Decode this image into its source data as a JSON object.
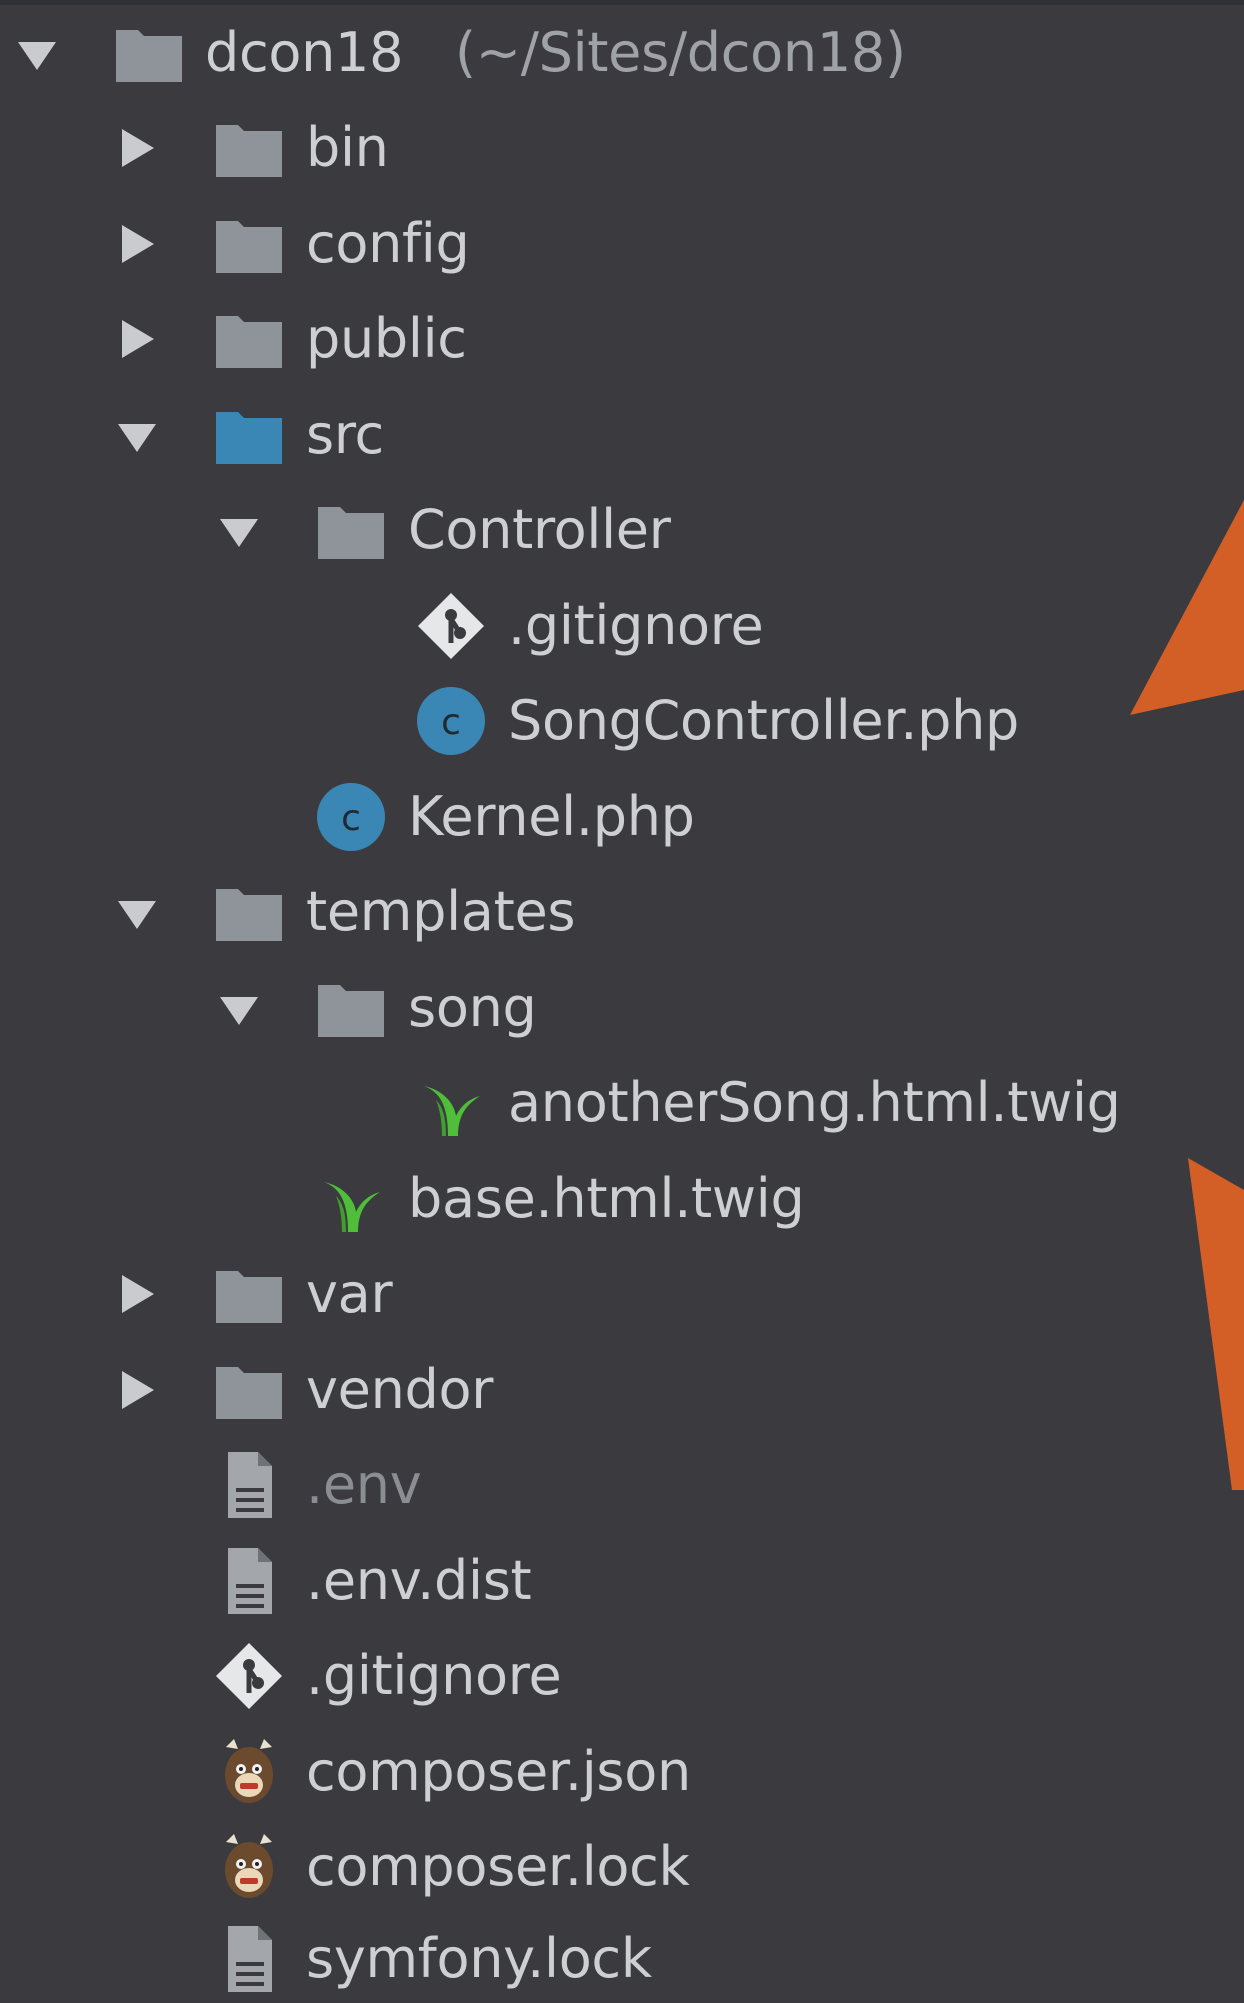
{
  "project": {
    "name": "dcon18",
    "path": "(~/Sites/dcon18)"
  },
  "items": [
    {
      "label": "bin",
      "type": "folder",
      "state": "collapsed"
    },
    {
      "label": "config",
      "type": "folder",
      "state": "collapsed"
    },
    {
      "label": "public",
      "type": "folder",
      "state": "collapsed"
    },
    {
      "label": "src",
      "type": "folder-source",
      "state": "expanded"
    },
    {
      "label": "Controller",
      "type": "folder",
      "state": "expanded"
    },
    {
      "label": ".gitignore",
      "type": "git-file"
    },
    {
      "label": "SongController.php",
      "type": "php-class-file"
    },
    {
      "label": "Kernel.php",
      "type": "php-class-file"
    },
    {
      "label": "templates",
      "type": "folder",
      "state": "expanded"
    },
    {
      "label": "song",
      "type": "folder",
      "state": "expanded"
    },
    {
      "label": "anotherSong.html.twig",
      "type": "twig-file"
    },
    {
      "label": "base.html.twig",
      "type": "twig-file"
    },
    {
      "label": "var",
      "type": "folder",
      "state": "collapsed"
    },
    {
      "label": "vendor",
      "type": "folder",
      "state": "collapsed"
    },
    {
      "label": ".env",
      "type": "text-file",
      "ignored": true
    },
    {
      "label": ".env.dist",
      "type": "text-file"
    },
    {
      "label": ".gitignore",
      "type": "git-file"
    },
    {
      "label": "composer.json",
      "type": "composer-file"
    },
    {
      "label": "composer.lock",
      "type": "composer-file"
    },
    {
      "label": "symfony.lock",
      "type": "text-file"
    }
  ],
  "colors": {
    "background": "#3b3b3f",
    "text": "#cdcfd2",
    "folder": "#8e9499",
    "source_folder": "#3a87b5",
    "php_class": "#3a87b5",
    "twig": "#4fbf3a",
    "callout_arrow": "#d35f27"
  }
}
